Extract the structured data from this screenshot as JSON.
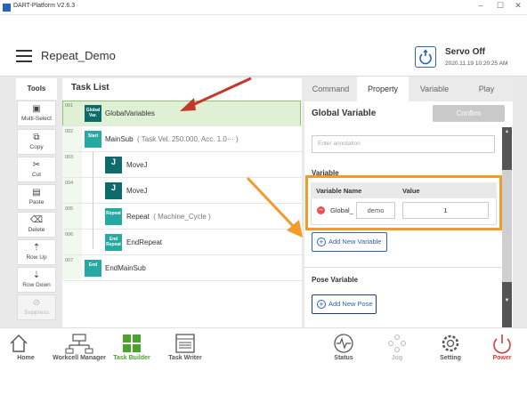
{
  "window": {
    "title": "DART-Platform V2.6.3",
    "controls": [
      "–",
      "☐",
      "✕"
    ]
  },
  "header": {
    "title": "Repeat_Demo",
    "servo_status": "Servo Off",
    "datetime": "2020.11.19 10:20:25 AM"
  },
  "tools": {
    "title": "Tools",
    "items": [
      {
        "label": "Multi-Select",
        "icon": "multi-select-icon",
        "glyph": "▣"
      },
      {
        "label": "Copy",
        "icon": "copy-icon",
        "glyph": "⧉"
      },
      {
        "label": "Cut",
        "icon": "cut-icon",
        "glyph": "✂"
      },
      {
        "label": "Paste",
        "icon": "paste-icon",
        "glyph": "📋"
      },
      {
        "label": "Delete",
        "icon": "delete-icon",
        "glyph": "🗑"
      },
      {
        "label": "Row Up",
        "icon": "row-up-icon",
        "glyph": "⇡"
      },
      {
        "label": "Row Down",
        "icon": "row-down-icon",
        "glyph": "⇣"
      },
      {
        "label": "Suppress",
        "icon": "suppress-icon",
        "glyph": "⊘"
      }
    ]
  },
  "tasklist": {
    "title": "Task List",
    "rows": [
      {
        "num": "001",
        "block": "Global Var.",
        "text": "GlobalVariables",
        "sub": ""
      },
      {
        "num": "002",
        "block": "Start",
        "text": "MainSub",
        "sub": "( Task Vel. 250.000, Acc. 1.0⋯ )"
      },
      {
        "num": "003",
        "block": "J",
        "text": "MoveJ",
        "sub": ""
      },
      {
        "num": "004",
        "block": "J",
        "text": "MoveJ",
        "sub": ""
      },
      {
        "num": "005",
        "block": "Repeat",
        "text": "Repeat",
        "sub": "( Machine_Cycle )"
      },
      {
        "num": "006",
        "block": "End Repeat",
        "text": "EndRepeat",
        "sub": ""
      },
      {
        "num": "007",
        "block": "End",
        "text": "EndMainSub",
        "sub": ""
      }
    ]
  },
  "property": {
    "tabs": [
      "Command",
      "Property",
      "Variable",
      "Play"
    ],
    "active_tab": "Property",
    "title": "Global Variable",
    "confirm": "Confirm",
    "annotation_placeholder": "Enter annotation",
    "variable_section": "Variable",
    "col_name": "Variable Name",
    "col_value": "Value",
    "var_prefix": "Global_",
    "var_name": "demo",
    "var_value": "1",
    "add_variable": "Add New Variable",
    "pose_section": "Pose Variable",
    "add_pose": "Add New Pose"
  },
  "bottom_nav": [
    {
      "label": "Home",
      "icon": "home-icon"
    },
    {
      "label": "Workcell Manager",
      "icon": "workcell-manager-icon"
    },
    {
      "label": "Task Builder",
      "icon": "task-builder-icon"
    },
    {
      "label": "Task Writer",
      "icon": "task-writer-icon"
    },
    {
      "label": "Status",
      "icon": "status-icon"
    },
    {
      "label": "Jog",
      "icon": "jog-icon"
    },
    {
      "label": "Setting",
      "icon": "setting-icon"
    },
    {
      "label": "Power",
      "icon": "power-icon"
    }
  ],
  "colors": {
    "accent_green": "#4aa32a",
    "brand_blue": "#2a63b8",
    "block_teal": "#26a9a2",
    "highlight_orange": "#f39a2a",
    "arrow_red": "#c0392b"
  }
}
